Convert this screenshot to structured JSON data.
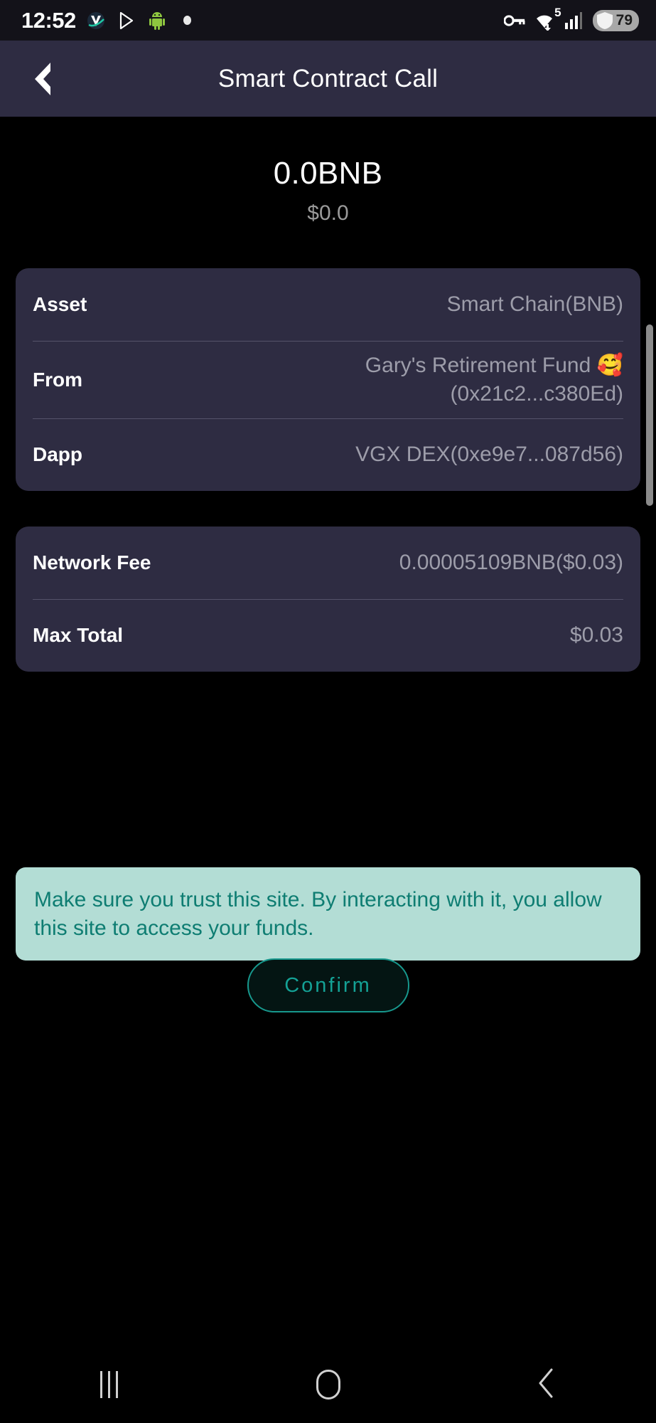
{
  "status_bar": {
    "time": "12:52",
    "left_icons": [
      "app-badge-icon",
      "play-store-icon",
      "android-robot-icon",
      "dot-icon"
    ],
    "right_icons": [
      "vpn-key-icon",
      "wifi-icon",
      "cellular-signal-icon",
      "battery-icon"
    ],
    "wifi_superscript": "5",
    "battery_level": "79"
  },
  "header": {
    "title": "Smart Contract Call",
    "back_icon": "back-chevron-icon"
  },
  "amount": {
    "value": "0.0BNB",
    "fiat": "$0.0"
  },
  "details_card": {
    "rows": [
      {
        "label": "Asset",
        "value": "Smart Chain(BNB)"
      },
      {
        "label": "From",
        "value": "Gary's Retirement Fund 🥰\n(0x21c2...c380Ed)"
      },
      {
        "label": "Dapp",
        "value": "VGX DEX(0xe9e7...087d56)"
      }
    ]
  },
  "fees_card": {
    "rows": [
      {
        "label": "Network Fee",
        "value": "0.00005109BNB($0.03)"
      },
      {
        "label": "Max Total",
        "value": "$0.03"
      }
    ]
  },
  "warning": {
    "text": "Make sure you trust this site. By interacting with it, you allow this site to access your funds."
  },
  "confirm": {
    "label": "Confirm"
  },
  "nav_bar": {
    "recents_icon": "recents-icon",
    "home_icon": "home-icon",
    "back_icon": "nav-back-icon"
  },
  "colors": {
    "background": "#000000",
    "card": "#2e2c42",
    "header": "#2e2c42",
    "status_bar": "#131219",
    "accent_teal": "#14a195",
    "warning_bg": "#b3ddd5",
    "warning_text": "#0e7d72",
    "value_text": "#9d9daa"
  }
}
